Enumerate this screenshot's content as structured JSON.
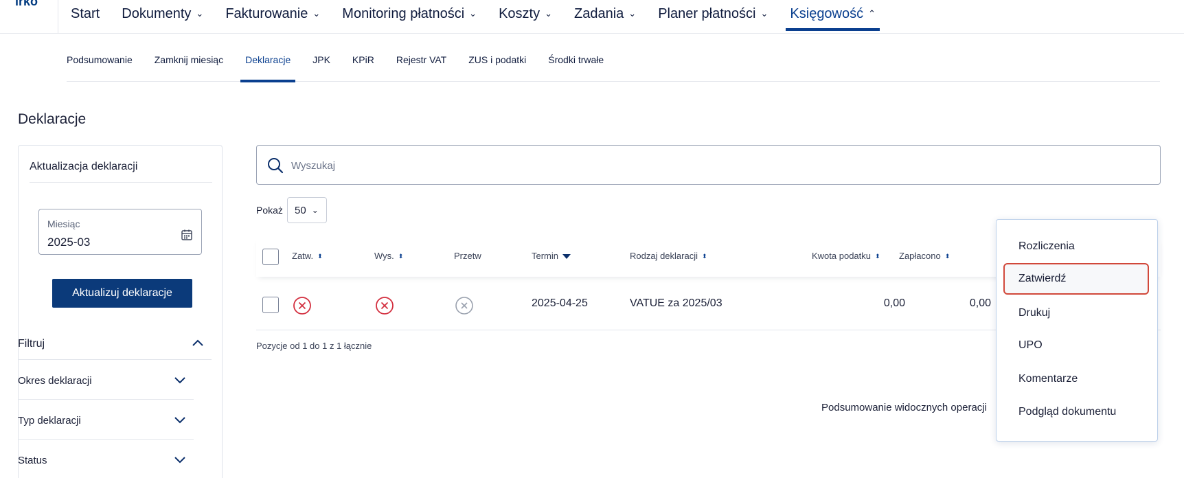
{
  "header": {
    "logo_fragment": "irko",
    "nav": [
      {
        "label": "Start",
        "has_menu": false
      },
      {
        "label": "Dokumenty",
        "has_menu": true
      },
      {
        "label": "Fakturowanie",
        "has_menu": true
      },
      {
        "label": "Monitoring płatności",
        "has_menu": true
      },
      {
        "label": "Koszty",
        "has_menu": true
      },
      {
        "label": "Zadania",
        "has_menu": true
      },
      {
        "label": "Planer płatności",
        "has_menu": true
      },
      {
        "label": "Księgowość",
        "has_menu": true,
        "active": true
      }
    ]
  },
  "subnav": [
    {
      "label": "Podsumowanie"
    },
    {
      "label": "Zamknij miesiąc"
    },
    {
      "label": "Deklaracje",
      "active": true
    },
    {
      "label": "JPK"
    },
    {
      "label": "KPiR"
    },
    {
      "label": "Rejestr VAT"
    },
    {
      "label": "ZUS i podatki"
    },
    {
      "label": "Środki trwałe"
    }
  ],
  "page": {
    "title": "Deklaracje"
  },
  "sidebar": {
    "heading": "Aktualizacja deklaracji",
    "month_label": "Miesiąc",
    "month_value": "2025-03",
    "update_button": "Aktualizuj deklaracje",
    "filter_heading": "Filtruj",
    "filters": [
      "Okres deklaracji",
      "Typ deklaracji",
      "Status"
    ]
  },
  "search": {
    "placeholder": "Wyszukaj",
    "value": ""
  },
  "page_size": {
    "label": "Pokaż",
    "value": "50"
  },
  "table": {
    "columns": {
      "approved": "Zatw.",
      "sent": "Wys.",
      "processed": "Przetw",
      "deadline": "Termin",
      "type": "Rodzaj deklaracji",
      "tax_amount": "Kwota podatku",
      "paid": "Zapłacono"
    },
    "rows": [
      {
        "deadline": "2025-04-25",
        "type": "VATUE za 2025/03",
        "tax_amount": "0,00",
        "paid": "0,00"
      }
    ],
    "pagination_info": "Pozycje od 1 do 1 z 1 łącznie",
    "summary": "Podsumowanie widocznych operacji"
  },
  "context_menu": {
    "items": [
      {
        "label": "Rozliczenia"
      },
      {
        "label": "Zatwierdź",
        "highlighted": true
      },
      {
        "label": "Drukuj"
      },
      {
        "label": "UPO"
      },
      {
        "label": "Komentarze"
      },
      {
        "label": "Podgląd dokumentu"
      }
    ]
  },
  "colors": {
    "brand": "#0b3a7a",
    "accent": "#0a3f8f",
    "error": "#d32f3f",
    "neutral_icon": "#9aa1ae",
    "highlight_border": "#d1483a"
  }
}
